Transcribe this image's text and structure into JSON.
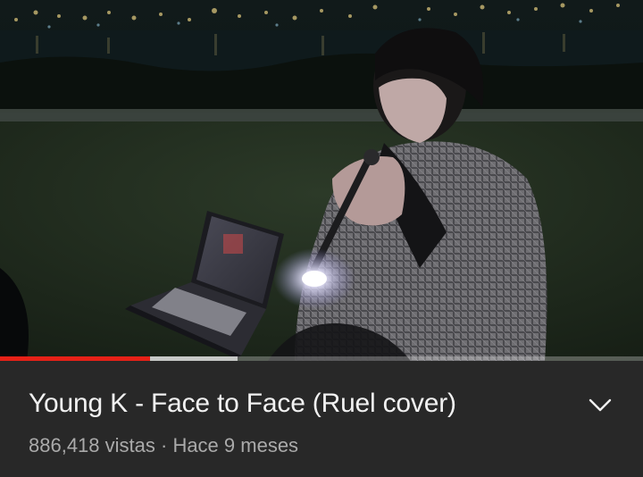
{
  "video": {
    "title": "Young K - Face to Face (Ruel cover)",
    "views": "886,418 vistas",
    "separator": " · ",
    "published": "Hace 9 meses"
  },
  "player": {
    "played_fraction": 0.233,
    "buffered_fraction": 0.37,
    "played_color": "#e62117"
  },
  "icons": {
    "expand": "chevron-down-icon"
  }
}
